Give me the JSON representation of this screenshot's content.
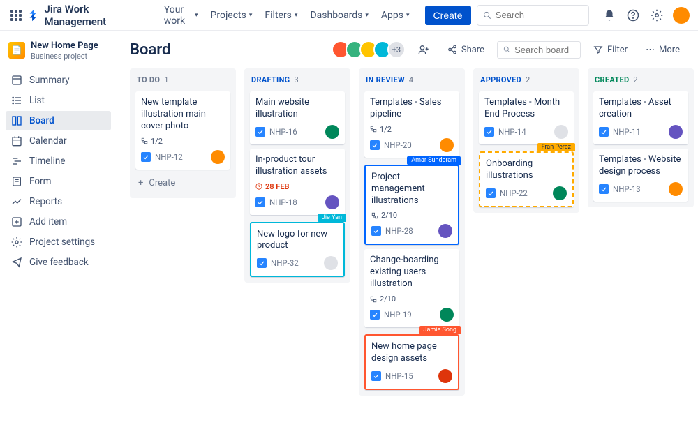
{
  "brand": "Jira Work Management",
  "nav": [
    "Your work",
    "Projects",
    "Filters",
    "Dashboards",
    "Apps"
  ],
  "create_label": "Create",
  "search_placeholder": "Search",
  "project": {
    "name": "New Home Page",
    "type": "Business project"
  },
  "sidebar": [
    {
      "id": "summary",
      "label": "Summary"
    },
    {
      "id": "list",
      "label": "List"
    },
    {
      "id": "board",
      "label": "Board",
      "active": true
    },
    {
      "id": "calendar",
      "label": "Calendar"
    },
    {
      "id": "timeline",
      "label": "Timeline"
    },
    {
      "id": "form",
      "label": "Form"
    },
    {
      "id": "reports",
      "label": "Reports"
    },
    {
      "id": "add",
      "label": "Add item"
    },
    {
      "id": "settings",
      "label": "Project settings"
    },
    {
      "id": "feedback",
      "label": "Give feedback"
    }
  ],
  "page_title": "Board",
  "header": {
    "more_count": "+3",
    "share": "Share",
    "search_placeholder": "Search board",
    "filter": "Filter",
    "more": "More"
  },
  "create_card_label": "Create",
  "columns": [
    {
      "id": "TODO",
      "title": "TO DO",
      "count": 1
    },
    {
      "id": "DRAFTING",
      "title": "DRAFTING",
      "count": 3
    },
    {
      "id": "INREVIEW",
      "title": "IN REVIEW",
      "count": 4
    },
    {
      "id": "APPROVED",
      "title": "APPROVED",
      "count": 2
    },
    {
      "id": "CREATED",
      "title": "CREATED",
      "count": 2
    }
  ],
  "cards": {
    "TODO": [
      {
        "title": "New template illustration main cover photo",
        "key": "NHP-12",
        "sub": "1/2",
        "assignee": "av1"
      }
    ],
    "DRAFTING": [
      {
        "title": "Main website illustration",
        "key": "NHP-16",
        "assignee": "av2"
      },
      {
        "title": "In-product tour illustration assets",
        "key": "NHP-18",
        "due": "28 FEB",
        "assignee": "av3",
        "flag": {
          "name": "Jie Yan",
          "color": "teal",
          "pos": "bottom"
        }
      },
      {
        "title": "New logo for new product",
        "key": "NHP-32",
        "assignee": "none",
        "border": "teal"
      }
    ],
    "INREVIEW": [
      {
        "title": "Templates - Sales pipeline",
        "key": "NHP-20",
        "sub": "1/2",
        "assignee": "av1",
        "flag": {
          "name": "Amar Sunderam",
          "color": "blue",
          "pos": "bottom"
        }
      },
      {
        "title": "Project management illustrations",
        "key": "NHP-28",
        "sub": "2/10",
        "assignee": "av3",
        "border": "blue"
      },
      {
        "title": "Change-boarding existing users illustration",
        "key": "NHP-19",
        "sub": "2/10",
        "assignee": "av2",
        "flag": {
          "name": "Jamie Song",
          "color": "orange",
          "pos": "bottom"
        }
      },
      {
        "title": "New home page design assets",
        "key": "NHP-15",
        "assignee": "av4",
        "border": "orange"
      }
    ],
    "APPROVED": [
      {
        "title": "Templates - Month End Process",
        "key": "NHP-14",
        "assignee": "none",
        "flag": {
          "name": "Fran Perez",
          "color": "amber",
          "pos": "bottom"
        }
      },
      {
        "title": "Onboarding illustrations",
        "key": "NHP-22",
        "assignee": "av2",
        "border": "amber"
      }
    ],
    "CREATED": [
      {
        "title": "Templates - Asset creation",
        "key": "NHP-11",
        "assignee": "av3"
      },
      {
        "title": "Templates - Website design process",
        "key": "NHP-13",
        "assignee": "av1"
      }
    ]
  },
  "avatar_colors": {
    "av1": "#FF8B00",
    "av2": "#00875A",
    "av3": "#6554C0",
    "av4": "#DE350B",
    "none": "#DFE1E6"
  }
}
